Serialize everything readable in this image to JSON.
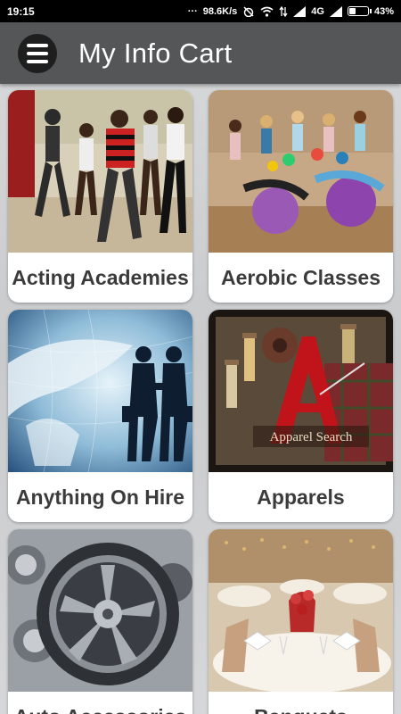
{
  "status_bar": {
    "time": "19:15",
    "speed": "98.6K/s",
    "network": "4G",
    "battery_percent": 43,
    "battery_label": "43%"
  },
  "app_bar": {
    "title": "My Info Cart",
    "menu_icon": "hamburger-menu-icon"
  },
  "categories": [
    {
      "label": "Acting Academies",
      "image": "dance-class-photo"
    },
    {
      "label": "Aerobic Classes",
      "image": "aerobics-balls-photo"
    },
    {
      "label": "Anything On Hire",
      "image": "business-handshake-globe-photo"
    },
    {
      "label": "Apparels",
      "image": "apparel-search-threads-photo"
    },
    {
      "label": "Auto Accessories",
      "image": "alloy-wheel-photo"
    },
    {
      "label": "Banquets",
      "image": "banquet-table-photo"
    }
  ],
  "colors": {
    "app_bar": "#555657",
    "menu_button": "#1e1e1e",
    "card_text": "#3b3b3b"
  }
}
